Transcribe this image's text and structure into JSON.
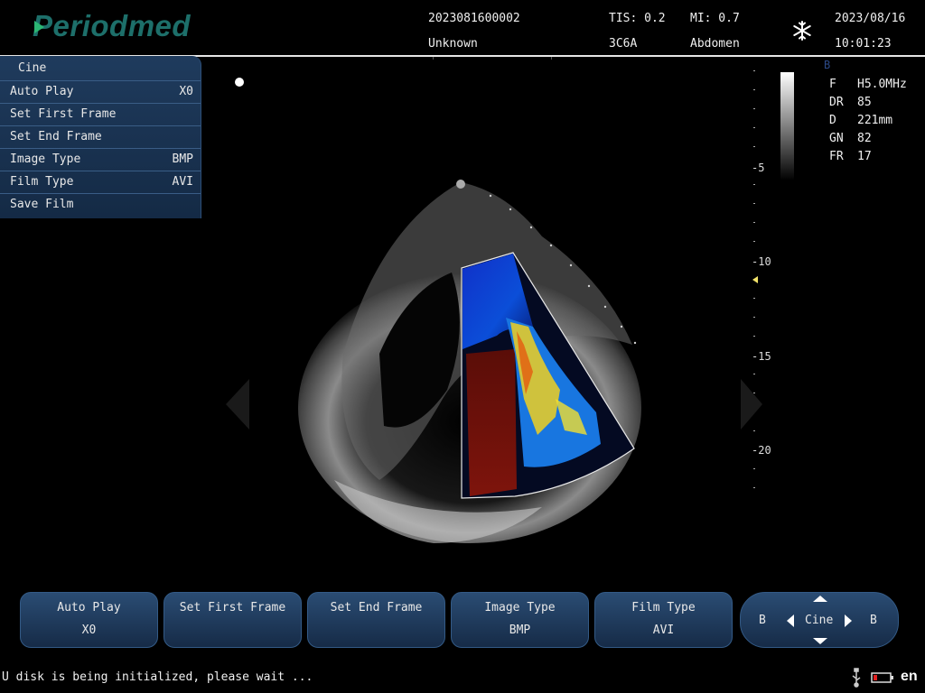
{
  "header": {
    "logo_text": "Periodmed",
    "patient_id": "2023081600002",
    "patient_name": "Unknown",
    "tis": "TIS: 0.2",
    "mi": "MI: 0.7",
    "probe": "3C6A",
    "preset": "Abdomen",
    "date": "2023/08/16",
    "time": "10:01:23"
  },
  "side_menu": {
    "title": "Cine",
    "items": [
      {
        "label": "Auto Play",
        "value": "X0"
      },
      {
        "label": "Set First Frame",
        "value": ""
      },
      {
        "label": "Set End Frame",
        "value": ""
      },
      {
        "label": "Image Type",
        "value": "BMP"
      },
      {
        "label": "Film Type",
        "value": "AVI"
      },
      {
        "label": "Save Film",
        "value": ""
      }
    ]
  },
  "depth_scale": {
    "labels": [
      "-5",
      "-10",
      "-15",
      "-20"
    ]
  },
  "params": {
    "mode": "B",
    "rows": [
      {
        "key": "F",
        "value": "H5.0MHz"
      },
      {
        "key": "DR",
        "value": "85"
      },
      {
        "key": "D",
        "value": "221mm"
      },
      {
        "key": "GN",
        "value": "82"
      },
      {
        "key": "FR",
        "value": "17"
      }
    ]
  },
  "bottom_buttons": [
    {
      "label": "Auto Play",
      "value": "X0"
    },
    {
      "label": "Set First Frame",
      "value": ""
    },
    {
      "label": "Set End Frame",
      "value": ""
    },
    {
      "label": "Image Type",
      "value": "BMP"
    },
    {
      "label": "Film Type",
      "value": "AVI"
    }
  ],
  "cine_control": {
    "left": "B",
    "center": "Cine",
    "right": "B"
  },
  "status": {
    "message": "U disk is being initialized, please wait ...",
    "language": "en"
  },
  "colors": {
    "menu_bg": "#1f3b5d",
    "logo": "#1d6f6a",
    "focus_marker": "#f3e36a"
  }
}
